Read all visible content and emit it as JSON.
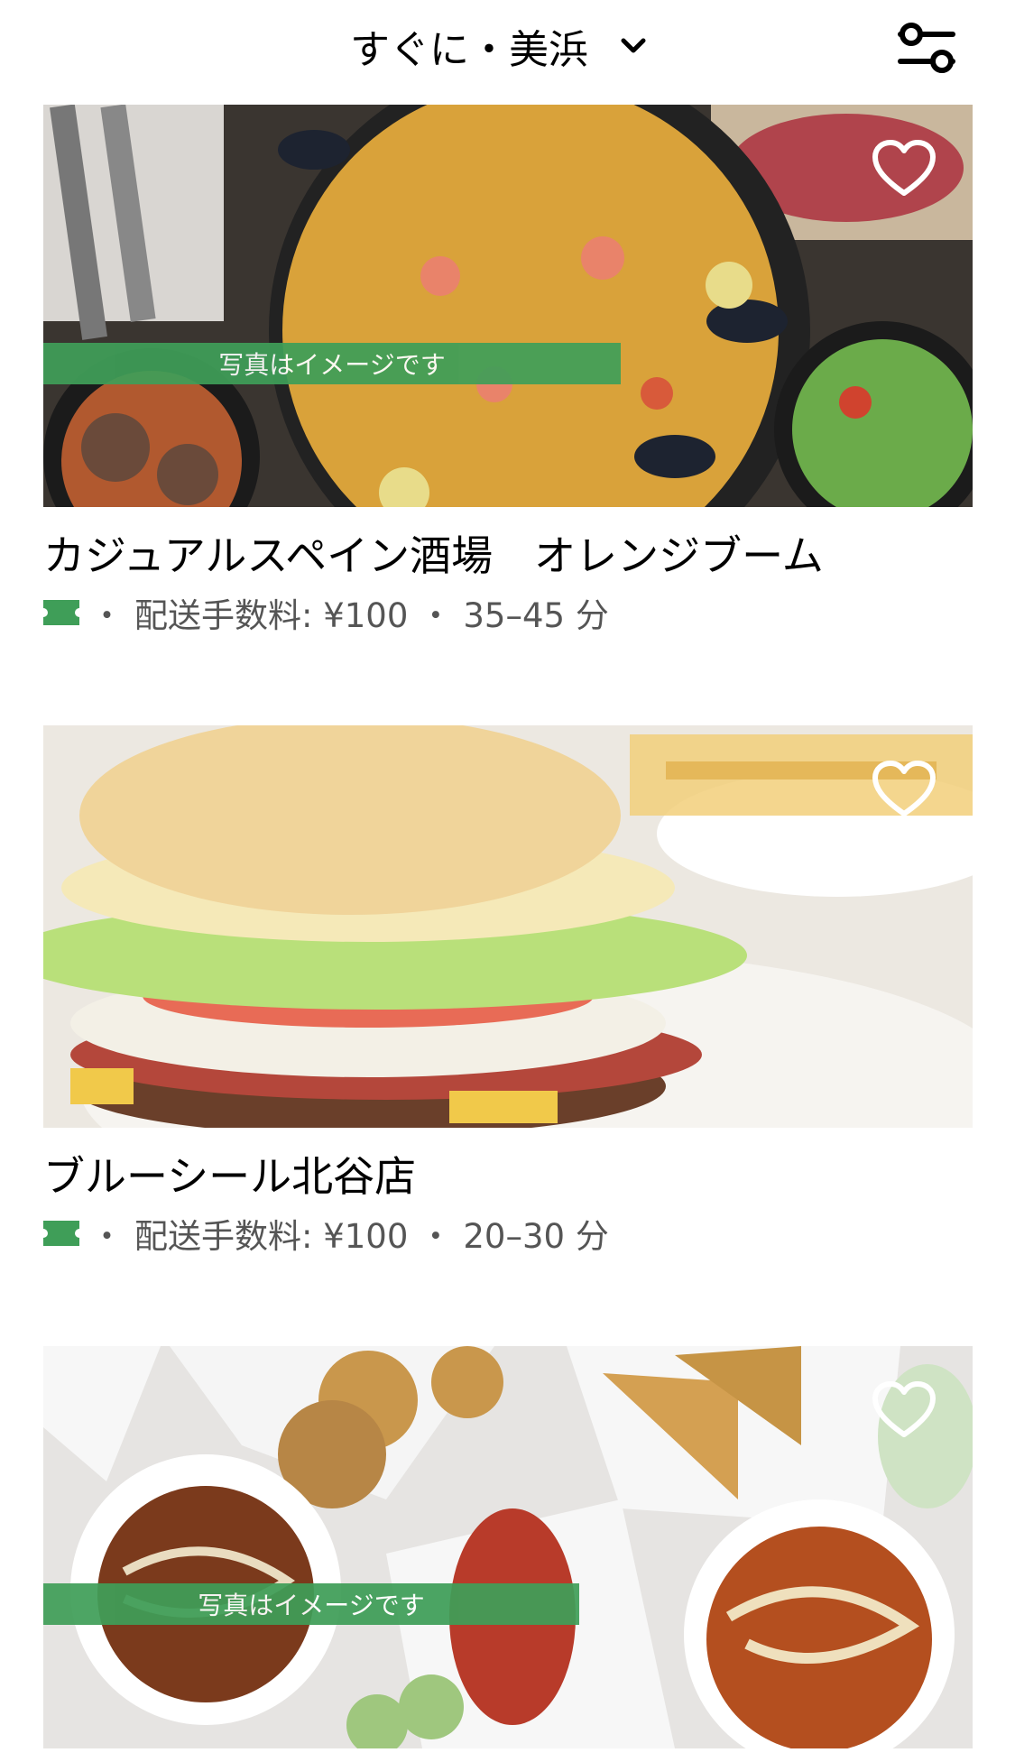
{
  "header": {
    "location_label": "すぐに・美浜",
    "icons": {
      "dropdown": "chevron-down-icon",
      "filter": "filter-sliders-icon"
    }
  },
  "colors": {
    "banner_green": "#3f9e58",
    "text_gray": "#555555"
  },
  "restaurants": [
    {
      "name": "カジュアルスペイン酒場　オレンジブーム",
      "promo_icon": "ticket-icon",
      "fee": "配送手数料: ¥100",
      "eta": "35–45 分",
      "image_note": "写真はイメージです"
    },
    {
      "name": "ブルーシール北谷店",
      "promo_icon": "ticket-icon",
      "fee": "配送手数料: ¥100",
      "eta": "20–30 分"
    },
    {
      "name": "",
      "image_note": "写真はイメージです"
    }
  ]
}
